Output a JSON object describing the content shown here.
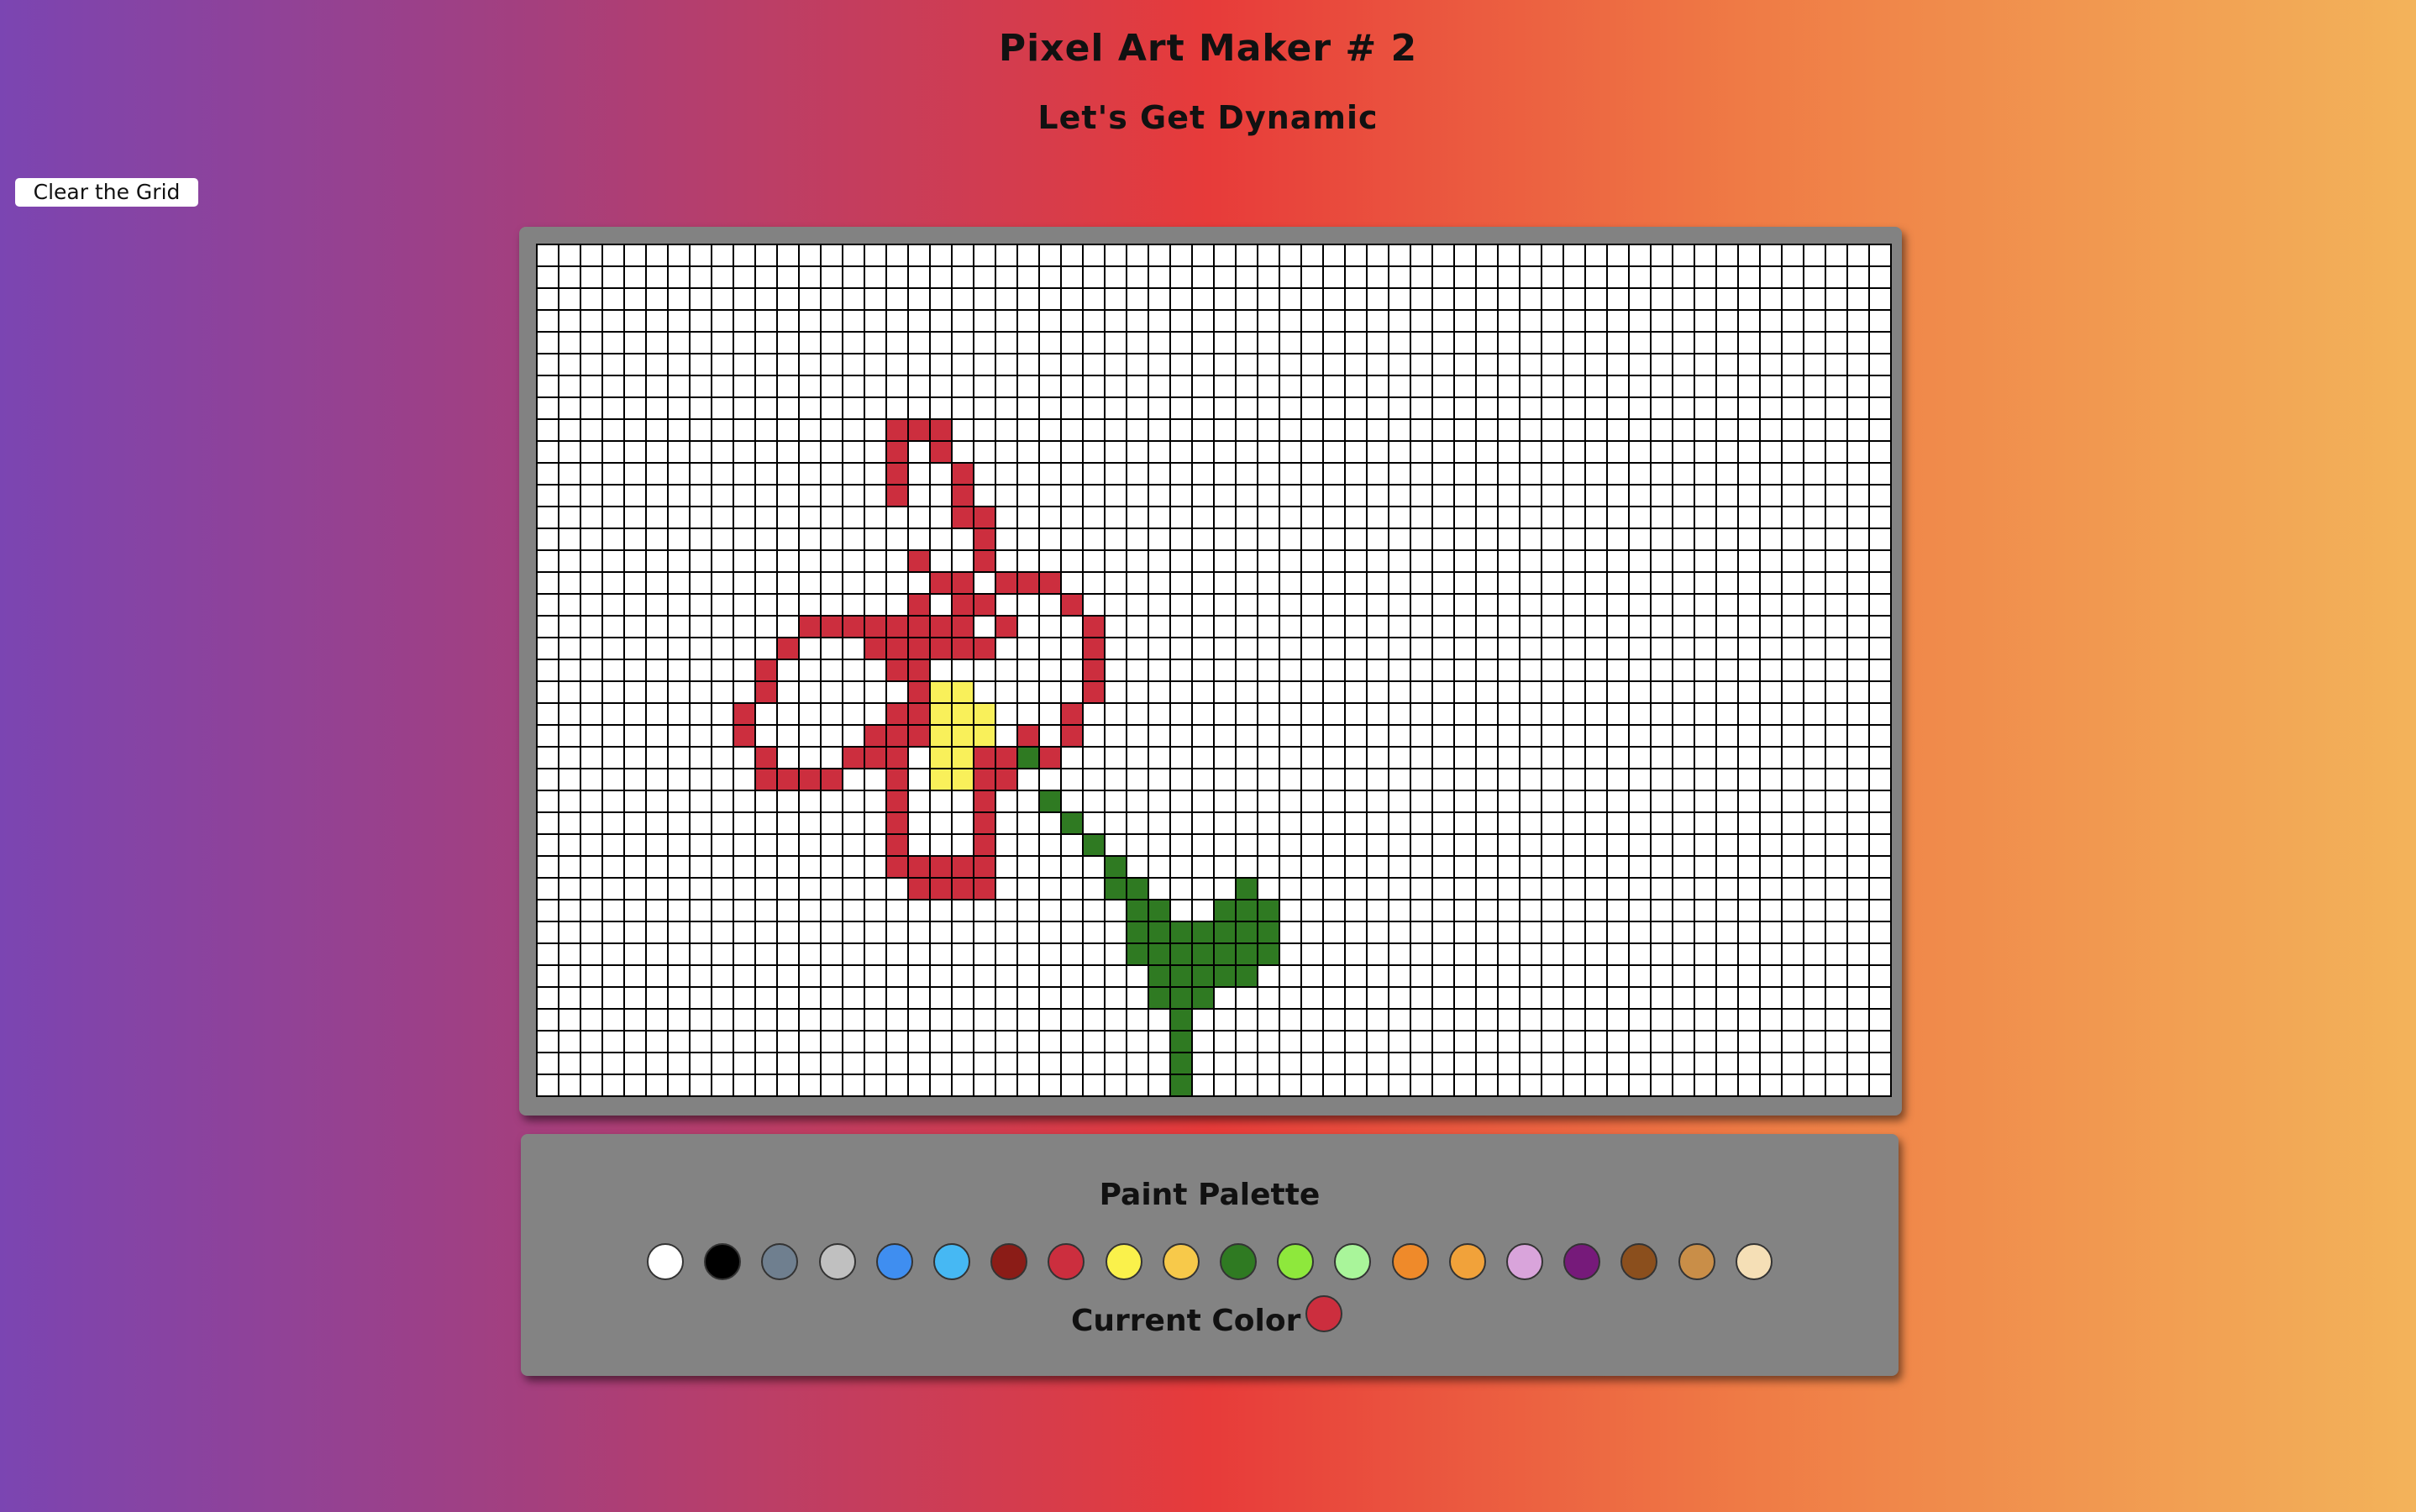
{
  "page": {
    "title": "Pixel Art Maker # 2",
    "subtitle": "Let's Get Dynamic"
  },
  "controls": {
    "clear_label": "Clear the Grid"
  },
  "grid": {
    "columns": 62,
    "rows": 39,
    "empty_color": "#ffffff",
    "painted": {
      "#cc2e3e": [
        [
          8,
          16
        ],
        [
          8,
          17
        ],
        [
          8,
          18
        ],
        [
          9,
          16
        ],
        [
          9,
          18
        ],
        [
          10,
          16
        ],
        [
          10,
          19
        ],
        [
          11,
          16
        ],
        [
          11,
          19
        ],
        [
          12,
          19
        ],
        [
          12,
          20
        ],
        [
          13,
          20
        ],
        [
          14,
          17
        ],
        [
          14,
          20
        ],
        [
          15,
          18
        ],
        [
          15,
          19
        ],
        [
          15,
          21
        ],
        [
          15,
          22
        ],
        [
          15,
          23
        ],
        [
          16,
          17
        ],
        [
          16,
          19
        ],
        [
          16,
          20
        ],
        [
          16,
          24
        ],
        [
          17,
          12
        ],
        [
          17,
          13
        ],
        [
          17,
          14
        ],
        [
          17,
          15
        ],
        [
          17,
          16
        ],
        [
          17,
          17
        ],
        [
          17,
          18
        ],
        [
          17,
          19
        ],
        [
          17,
          21
        ],
        [
          17,
          25
        ],
        [
          18,
          11
        ],
        [
          18,
          15
        ],
        [
          18,
          16
        ],
        [
          18,
          17
        ],
        [
          18,
          18
        ],
        [
          18,
          19
        ],
        [
          18,
          20
        ],
        [
          18,
          25
        ],
        [
          19,
          10
        ],
        [
          19,
          16
        ],
        [
          19,
          17
        ],
        [
          19,
          25
        ],
        [
          20,
          10
        ],
        [
          20,
          17
        ],
        [
          20,
          25
        ],
        [
          21,
          9
        ],
        [
          21,
          16
        ],
        [
          21,
          17
        ],
        [
          21,
          24
        ],
        [
          22,
          9
        ],
        [
          22,
          15
        ],
        [
          22,
          16
        ],
        [
          22,
          17
        ],
        [
          22,
          22
        ],
        [
          22,
          24
        ],
        [
          23,
          10
        ],
        [
          23,
          14
        ],
        [
          23,
          15
        ],
        [
          23,
          16
        ],
        [
          23,
          20
        ],
        [
          23,
          21
        ],
        [
          23,
          22
        ],
        [
          23,
          23
        ],
        [
          24,
          10
        ],
        [
          24,
          11
        ],
        [
          24,
          12
        ],
        [
          24,
          13
        ],
        [
          24,
          16
        ],
        [
          24,
          20
        ],
        [
          24,
          21
        ],
        [
          25,
          16
        ],
        [
          25,
          20
        ],
        [
          26,
          16
        ],
        [
          26,
          20
        ],
        [
          27,
          16
        ],
        [
          27,
          20
        ],
        [
          28,
          16
        ],
        [
          28,
          17
        ],
        [
          28,
          18
        ],
        [
          28,
          19
        ],
        [
          28,
          20
        ],
        [
          29,
          17
        ],
        [
          29,
          18
        ],
        [
          29,
          19
        ],
        [
          29,
          20
        ]
      ],
      "#f9f05a": [
        [
          20,
          18
        ],
        [
          20,
          19
        ],
        [
          21,
          18
        ],
        [
          21,
          19
        ],
        [
          21,
          20
        ],
        [
          22,
          18
        ],
        [
          22,
          19
        ],
        [
          22,
          20
        ],
        [
          23,
          18
        ],
        [
          23,
          19
        ],
        [
          24,
          18
        ],
        [
          24,
          19
        ]
      ],
      "#2f7a22": [
        [
          23,
          22
        ],
        [
          25,
          23
        ],
        [
          26,
          24
        ],
        [
          27,
          25
        ],
        [
          28,
          26
        ],
        [
          29,
          26
        ],
        [
          29,
          27
        ],
        [
          29,
          32
        ],
        [
          30,
          27
        ],
        [
          30,
          28
        ],
        [
          30,
          31
        ],
        [
          30,
          32
        ],
        [
          30,
          33
        ],
        [
          31,
          27
        ],
        [
          31,
          28
        ],
        [
          31,
          29
        ],
        [
          31,
          30
        ],
        [
          31,
          31
        ],
        [
          31,
          32
        ],
        [
          31,
          33
        ],
        [
          32,
          27
        ],
        [
          32,
          28
        ],
        [
          32,
          29
        ],
        [
          32,
          30
        ],
        [
          32,
          31
        ],
        [
          32,
          32
        ],
        [
          32,
          33
        ],
        [
          33,
          28
        ],
        [
          33,
          29
        ],
        [
          33,
          30
        ],
        [
          33,
          31
        ],
        [
          33,
          32
        ],
        [
          34,
          28
        ],
        [
          34,
          29
        ],
        [
          34,
          30
        ],
        [
          35,
          29
        ],
        [
          36,
          29
        ],
        [
          37,
          29
        ],
        [
          38,
          29
        ]
      ]
    }
  },
  "palette": {
    "title": "Paint Palette",
    "swatches": [
      {
        "name": "white",
        "color": "#ffffff"
      },
      {
        "name": "black",
        "color": "#000000"
      },
      {
        "name": "slate-gray",
        "color": "#6f7f8f"
      },
      {
        "name": "silver",
        "color": "#c0c0c0"
      },
      {
        "name": "blue",
        "color": "#3f8ef0"
      },
      {
        "name": "sky-blue",
        "color": "#46b8f3"
      },
      {
        "name": "maroon",
        "color": "#8b1c17"
      },
      {
        "name": "crimson",
        "color": "#cc2e3e"
      },
      {
        "name": "yellow",
        "color": "#faf14b"
      },
      {
        "name": "gold",
        "color": "#f7c94a"
      },
      {
        "name": "green",
        "color": "#2f7a22"
      },
      {
        "name": "lime",
        "color": "#8ee83c"
      },
      {
        "name": "light-green",
        "color": "#a9f59a"
      },
      {
        "name": "orange",
        "color": "#ef8a2a"
      },
      {
        "name": "light-orange",
        "color": "#f1a23a"
      },
      {
        "name": "lavender",
        "color": "#d9a4db"
      },
      {
        "name": "purple",
        "color": "#761a7a"
      },
      {
        "name": "brown",
        "color": "#8b4f1d"
      },
      {
        "name": "tan",
        "color": "#c98e48"
      },
      {
        "name": "cream",
        "color": "#f5dfb6"
      }
    ],
    "current_label": "Current Color",
    "current_color": "#cc2e3e"
  }
}
